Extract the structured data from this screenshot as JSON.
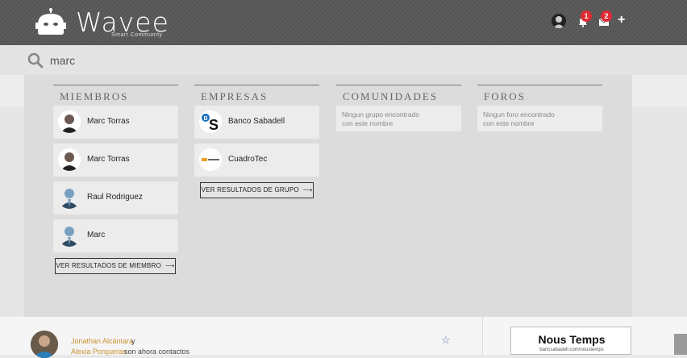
{
  "brand": {
    "name": "Wavee",
    "tagline": "Smart Community"
  },
  "header": {
    "notifications_count": "1",
    "messages_count": "2",
    "add_label": "+"
  },
  "search": {
    "value": "marc"
  },
  "results": {
    "members": {
      "title": "MIEMBROS",
      "items": [
        {
          "name": "Marc Torras"
        },
        {
          "name": "Marc Torras"
        },
        {
          "name": "Raul Rodriguez"
        },
        {
          "name": "Marc"
        }
      ],
      "more_label": "VER RESULTADOS DE MIEMBRO"
    },
    "companies": {
      "title": "EMPRESAS",
      "items": [
        {
          "name": "Banco Sabadell"
        },
        {
          "name": "CuadroTec"
        }
      ],
      "more_label": "VER RESULTADOS DE GRUPO"
    },
    "communities": {
      "title": "COMUNIDADES",
      "empty_line1": "Ningun grupo encontrado",
      "empty_line2": "con este nombre"
    },
    "forums": {
      "title": "FOROS",
      "empty_line1": "Ningun foro encontrado",
      "empty_line2": "con este nombre"
    }
  },
  "feed": {
    "name1": "Jonathan Alcántara",
    "connector": "y",
    "name2": "Alexia Porqueras",
    "text": "son ahora contactos"
  },
  "ad": {
    "title": "Nous Temps",
    "url": "bancsabadell.com/noustemps"
  },
  "colors": {
    "badge": "#e02c35",
    "link": "#c9922f",
    "star": "#6470a8"
  }
}
